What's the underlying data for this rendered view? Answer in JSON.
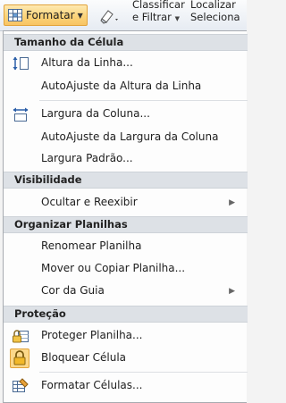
{
  "ribbon": {
    "format_button": "Formatar",
    "sort_line1": "Classificar",
    "sort_line2": "e Filtrar",
    "find_line1": "Localizar",
    "find_line2": "Seleciona"
  },
  "menu": {
    "section_cell_size": "Tamanho da Célula",
    "row_height": "Altura da Linha...",
    "autofit_row": "AutoAjuste da Altura da Linha",
    "column_width": "Largura da Coluna...",
    "autofit_column": "AutoAjuste da Largura da Coluna",
    "default_width": "Largura Padrão...",
    "section_visibility": "Visibilidade",
    "hide_unhide": "Ocultar e Reexibir",
    "section_organize": "Organizar Planilhas",
    "rename_sheet": "Renomear Planilha",
    "move_copy_sheet": "Mover ou Copiar Planilha...",
    "tab_color": "Cor da Guia",
    "section_protection": "Proteção",
    "protect_sheet": "Proteger Planilha...",
    "lock_cell": "Bloquear Célula",
    "format_cells": "Formatar Células..."
  },
  "colors": {
    "accent_button": "#fbd47a",
    "header_band": "#dde1e6",
    "lock_highlight": "#fcd88a"
  }
}
